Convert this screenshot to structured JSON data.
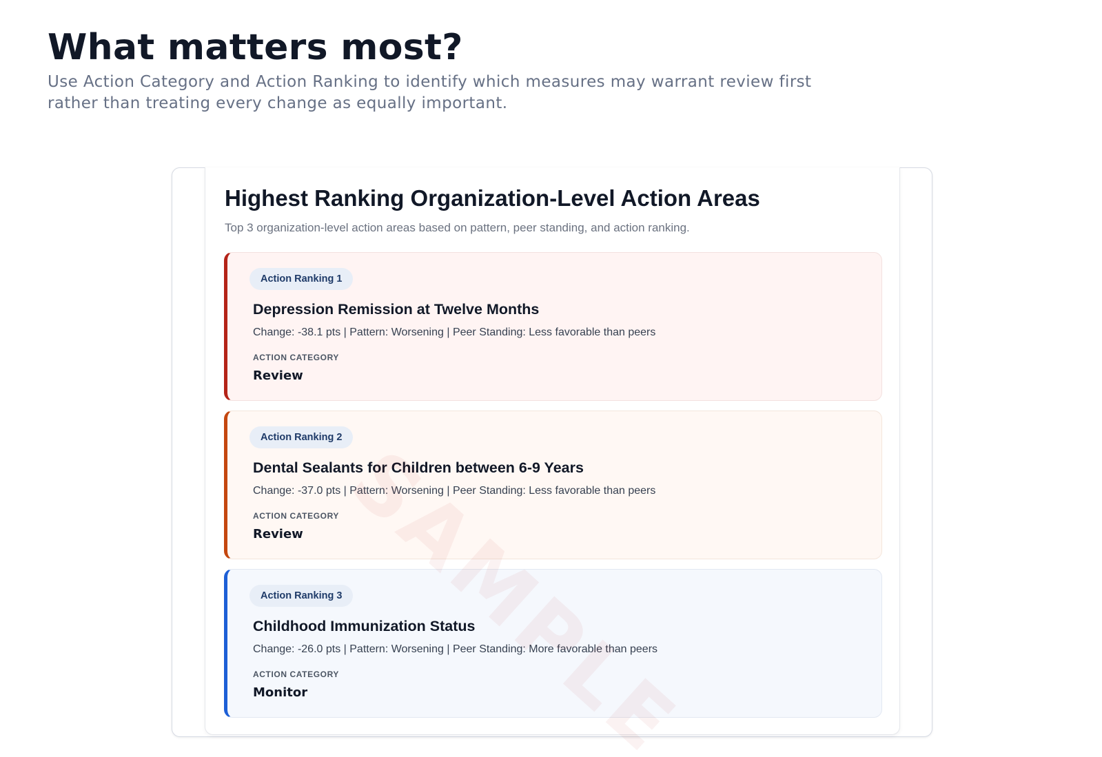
{
  "header": {
    "title": "What matters most?",
    "subtitle": "Use Action Category and Action Ranking to identify which measures may warrant review first rather than treating every change as equally important."
  },
  "panel": {
    "title": "Highest Ranking Organization-Level Action Areas",
    "subtitle": "Top 3 organization-level action areas based on pattern, peer standing, and action ranking."
  },
  "category_label": "ACTION CATEGORY",
  "cards": [
    {
      "rank_label": "Action Ranking 1",
      "measure": "Depression Remission at Twelve Months",
      "details": "Change: -38.1 pts | Pattern: Worsening | Peer Standing: Less favorable than peers",
      "category": "Review",
      "accent_color": "#b42318"
    },
    {
      "rank_label": "Action Ranking 2",
      "measure": "Dental Sealants for Children between 6-9 Years",
      "details": "Change: -37.0 pts | Pattern: Worsening | Peer Standing: Less favorable than peers",
      "category": "Review",
      "accent_color": "#c4470f"
    },
    {
      "rank_label": "Action Ranking 3",
      "measure": "Childhood Immunization Status",
      "details": "Change: -26.0 pts | Pattern: Worsening | Peer Standing: More favorable than peers",
      "category": "Monitor",
      "accent_color": "#1d5fd6"
    }
  ],
  "watermark": "SAMPLE"
}
